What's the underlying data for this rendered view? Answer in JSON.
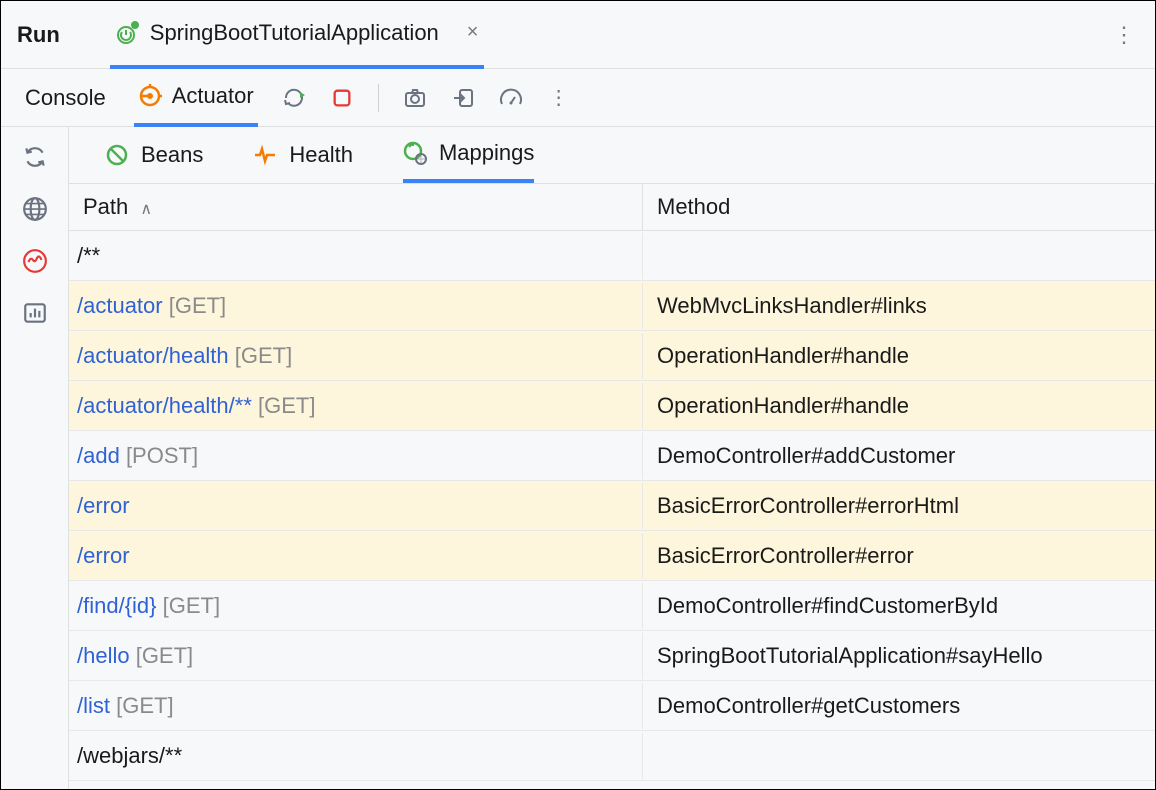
{
  "topbar": {
    "run_label": "Run",
    "app_tab_label": "SpringBootTutorialApplication"
  },
  "subbar": {
    "console_label": "Console",
    "actuator_label": "Actuator"
  },
  "inner_tabs": {
    "beans": "Beans",
    "health": "Health",
    "mappings": "Mappings"
  },
  "table": {
    "headers": {
      "path": "Path",
      "method": "Method"
    },
    "rows": [
      {
        "path": "/**",
        "verb": "",
        "method": "",
        "highlighted": false,
        "link": false
      },
      {
        "path": "/actuator",
        "verb": "[GET]",
        "method": "WebMvcLinksHandler#links",
        "highlighted": true,
        "link": true
      },
      {
        "path": "/actuator/health",
        "verb": "[GET]",
        "method": "OperationHandler#handle",
        "highlighted": true,
        "link": true
      },
      {
        "path": "/actuator/health/**",
        "verb": "[GET]",
        "method": "OperationHandler#handle",
        "highlighted": true,
        "link": true
      },
      {
        "path": "/add",
        "verb": "[POST]",
        "method": "DemoController#addCustomer",
        "highlighted": false,
        "link": true
      },
      {
        "path": "/error",
        "verb": "",
        "method": "BasicErrorController#errorHtml",
        "highlighted": true,
        "link": true
      },
      {
        "path": "/error",
        "verb": "",
        "method": "BasicErrorController#error",
        "highlighted": true,
        "link": true
      },
      {
        "path": "/find/{id}",
        "verb": "[GET]",
        "method": "DemoController#findCustomerById",
        "highlighted": false,
        "link": true
      },
      {
        "path": "/hello",
        "verb": "[GET]",
        "method": "SpringBootTutorialApplication#sayHello",
        "highlighted": false,
        "link": true
      },
      {
        "path": "/list",
        "verb": "[GET]",
        "method": "DemoController#getCustomers",
        "highlighted": false,
        "link": true
      },
      {
        "path": "/webjars/**",
        "verb": "",
        "method": "",
        "highlighted": false,
        "link": false
      }
    ]
  }
}
